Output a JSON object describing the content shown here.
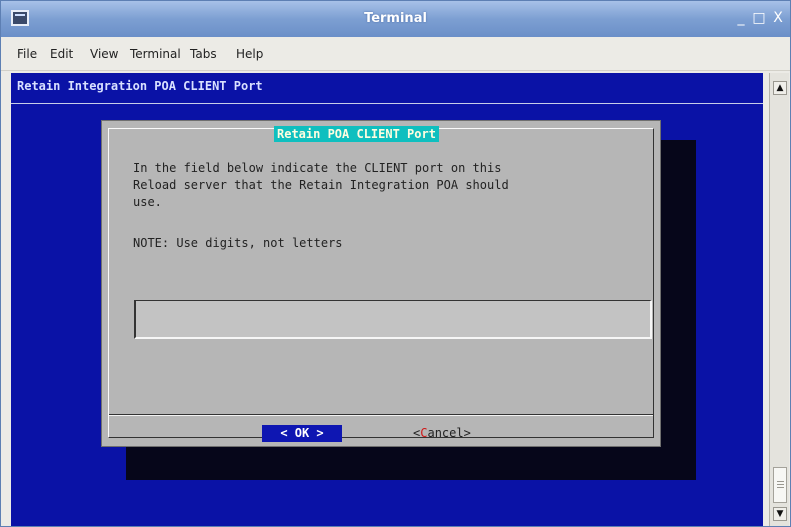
{
  "window": {
    "title": "Terminal",
    "buttons": {
      "minimize": "_",
      "maximize": "□",
      "close": "X"
    }
  },
  "menu": {
    "items": [
      {
        "label": "File"
      },
      {
        "label": "Edit"
      },
      {
        "label": "View"
      },
      {
        "label": "Terminal"
      },
      {
        "label": "Tabs"
      },
      {
        "label": "Help"
      }
    ]
  },
  "terminal": {
    "header": "Retain Integration POA CLIENT Port"
  },
  "dialog": {
    "title": "Retain POA CLIENT Port",
    "body": "In the field below indicate the CLIENT port on this\nReload server that the Retain Integration POA should\nuse.",
    "note": "NOTE: Use digits, not letters",
    "input_value": "",
    "ok_label": "<  OK  >",
    "cancel_prefix": "<",
    "cancel_hotkey": "C",
    "cancel_rest": "ancel>"
  },
  "scrollbar": {
    "up": "▲",
    "down": "▼"
  },
  "colors": {
    "terminal_bg": "#0a12a6",
    "dialog_bg": "#b6b6b6",
    "dialog_title_bg": "#0fbfbf",
    "ok_bg": "#0e16b2"
  }
}
